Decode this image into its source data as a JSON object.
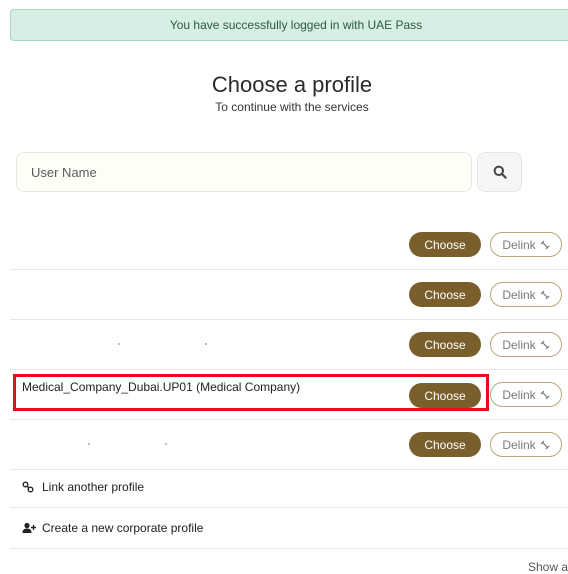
{
  "alert": {
    "message": "You have successfully logged in with UAE Pass"
  },
  "header": {
    "title": "Choose a profile",
    "subtitle": "To continue with the services"
  },
  "search": {
    "placeholder": "User Name",
    "icon": "search-icon"
  },
  "profiles": [
    {
      "name": "",
      "choose_label": "Choose",
      "delink_label": "Delink"
    },
    {
      "name": "",
      "choose_label": "Choose",
      "delink_label": "Delink"
    },
    {
      "name": "",
      "choose_label": "Choose",
      "delink_label": "Delink"
    },
    {
      "name": "Medical_Company_Dubai.UP01 (Medical Company)",
      "choose_label": "Choose",
      "delink_label": "Delink"
    },
    {
      "name": "",
      "choose_label": "Choose",
      "delink_label": "Delink"
    }
  ],
  "actions": {
    "link_profile": "Link another profile",
    "create_corporate": "Create a new corporate profile",
    "show_all": "Show a"
  },
  "colors": {
    "primary": "#7a5f2d",
    "highlight": "#e0101a",
    "alert_bg": "#d6eee3"
  }
}
